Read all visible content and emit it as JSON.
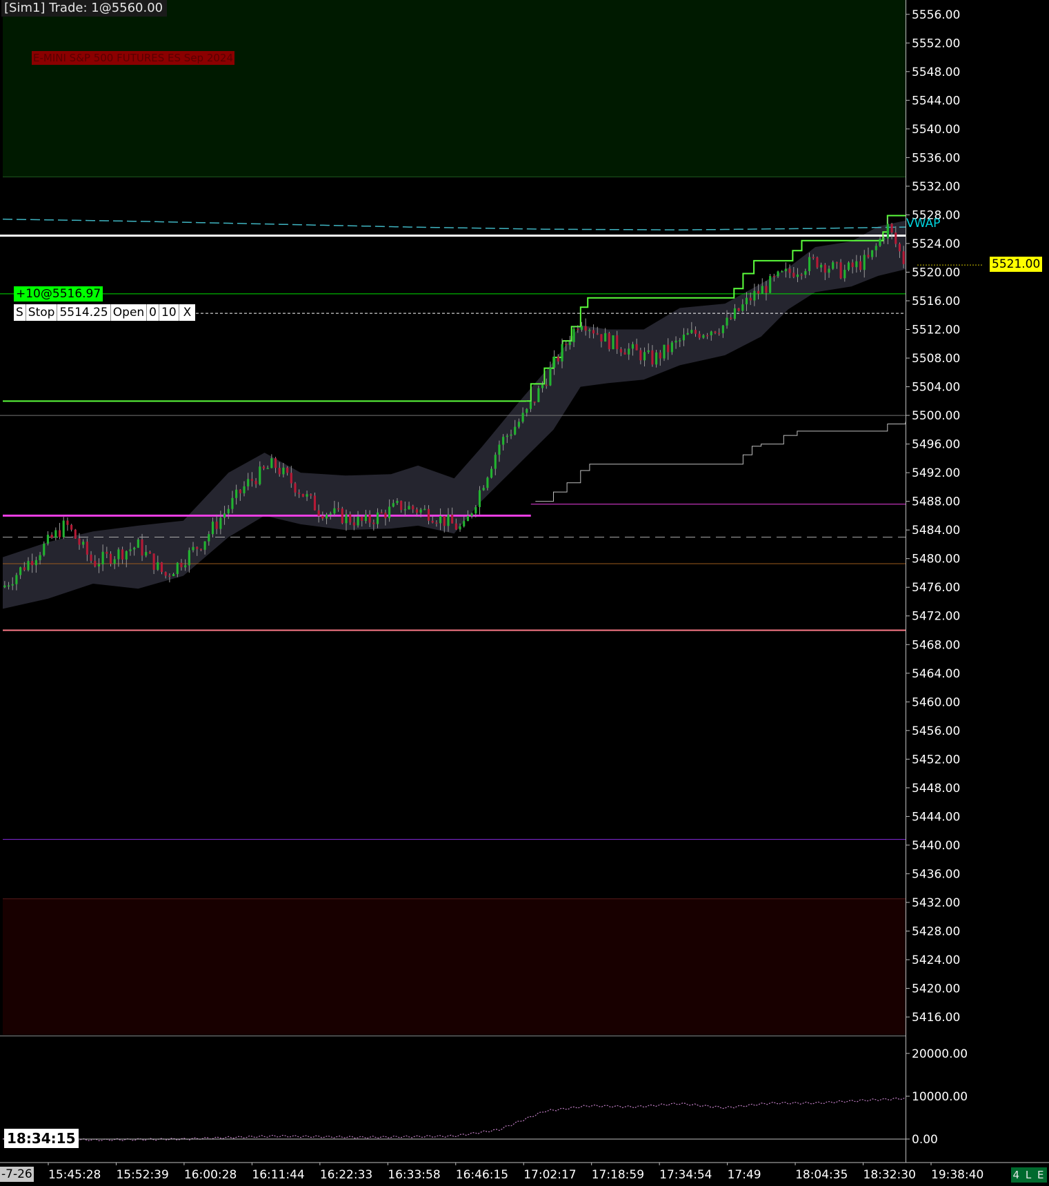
{
  "overlays": {
    "sim_trade": "[Sim1]  Trade: 1@5560.00",
    "instrument": "E-MINI S&P 500 FUTURES ES Sep 2024",
    "position": "+10@5516.97",
    "order": {
      "side": "S",
      "type": "Stop",
      "price": "5514.25",
      "state": "Open",
      "filled": "0",
      "qty": "10",
      "cancel": "X"
    },
    "last_price": "5521.00",
    "vwap_label": "VWAP",
    "clock": "18:34:15",
    "corner_date": "-7-26",
    "mode_badge": "4 L E"
  },
  "colors": {
    "background": "#000000",
    "up_candle": "#22b430",
    "down_candle": "#b51a36",
    "band_fill": "#25252f",
    "green_zone": "#001a00",
    "red_zone": "#180000",
    "stair_line": "#5cff3c",
    "vwap_line": "#3fb5c2",
    "white_level": "#ffffff",
    "green_level": "#00e000",
    "magenta_level": "#ee3fe6",
    "purple_level": "#8a2be2",
    "pink_level": "#ff7b8a",
    "orange_level": "#9c5a1c",
    "axis_text": "#ffffff",
    "last_price_bg": "#ffff00"
  },
  "chart_data": [
    {
      "type": "candlestick",
      "title": "",
      "y_axis": {
        "ticks": [
          "5556.00",
          "5552.00",
          "5548.00",
          "5544.00",
          "5540.00",
          "5536.00",
          "5532.00",
          "5528.00",
          "5524.00",
          "5520.00",
          "5516.00",
          "5512.00",
          "5508.00",
          "5504.00",
          "5500.00",
          "5496.00",
          "5492.00",
          "5488.00",
          "5484.00",
          "5480.00",
          "5476.00",
          "5472.00",
          "5468.00",
          "5464.00",
          "5460.00",
          "5456.00",
          "5452.00",
          "5448.00",
          "5444.00",
          "5440.00",
          "5436.00",
          "5432.00",
          "5428.00",
          "5424.00",
          "5420.00",
          "5416.00"
        ],
        "range": [
          5413.5,
          5558
        ]
      },
      "x_axis": {
        "ticks": [
          "15:45:28",
          "15:52:39",
          "16:00:28",
          "16:11:44",
          "16:22:33",
          "16:33:58",
          "16:46:15",
          "17:02:17",
          "17:18:59",
          "17:34:54",
          "17:49",
          "18:04:35",
          "18:32:30",
          "19:38:40"
        ]
      },
      "horizontal_levels": [
        {
          "name": "trade-level",
          "price": 5525.1,
          "color": "#ffffff"
        },
        {
          "name": "position-entry",
          "price": 5516.97,
          "color": "#00e000"
        },
        {
          "name": "stop-order",
          "price": 5514.25,
          "color": "#ffffff",
          "dashed": true
        },
        {
          "name": "prior-high-green",
          "price": 5502.0,
          "color": "#5cff3c"
        },
        {
          "name": "round-5500",
          "price": 5500.0,
          "color": "#777777"
        },
        {
          "name": "magenta-left",
          "price": 5486.0,
          "color": "#ee3fe6"
        },
        {
          "name": "magenta-right",
          "price": 5487.6,
          "color": "#ee3fe6"
        },
        {
          "name": "gray-dashed",
          "price": 5483.0,
          "color": "#aaaaaa",
          "dashed": true
        },
        {
          "name": "orange-level",
          "price": 5479.3,
          "color": "#9c5a1c"
        },
        {
          "name": "pink-level",
          "price": 5470.0,
          "color": "#ff7b8a"
        },
        {
          "name": "purple-level",
          "price": 5440.8,
          "color": "#8a2be2"
        }
      ],
      "zones": [
        {
          "name": "green-zone",
          "from": 5533.3,
          "to": 5558,
          "color": "#001a00"
        },
        {
          "name": "red-zone",
          "from": 5413.5,
          "to": 5432.5,
          "color": "#180000"
        }
      ],
      "vwap": [
        [
          0,
          5527.4
        ],
        [
          0.15,
          5527.1
        ],
        [
          0.3,
          5526.7
        ],
        [
          0.45,
          5526.3
        ],
        [
          0.6,
          5526.0
        ],
        [
          0.75,
          5525.9
        ],
        [
          0.9,
          5526.1
        ],
        [
          1.0,
          5526.3
        ]
      ],
      "stair_high": [
        [
          0.58,
          5502.0
        ],
        [
          0.585,
          5504.4
        ],
        [
          0.6,
          5506.6
        ],
        [
          0.61,
          5508.1
        ],
        [
          0.62,
          5510.4
        ],
        [
          0.63,
          5512.4
        ],
        [
          0.64,
          5515.1
        ],
        [
          0.648,
          5516.4
        ],
        [
          0.8,
          5516.4
        ],
        [
          0.81,
          5517.7
        ],
        [
          0.82,
          5519.8
        ],
        [
          0.832,
          5521.6
        ],
        [
          0.87,
          5521.6
        ],
        [
          0.875,
          5523.0
        ],
        [
          0.885,
          5524.4
        ],
        [
          0.97,
          5524.4
        ],
        [
          0.975,
          5525.6
        ],
        [
          0.98,
          5527.9
        ],
        [
          1.0,
          5527.9
        ]
      ],
      "stair_low": [
        [
          0.59,
          5488.0
        ],
        [
          0.61,
          5489.3
        ],
        [
          0.625,
          5490.6
        ],
        [
          0.64,
          5492.3
        ],
        [
          0.65,
          5493.2
        ],
        [
          0.816,
          5493.2
        ],
        [
          0.82,
          5494.5
        ],
        [
          0.83,
          5495.7
        ],
        [
          0.84,
          5496.0
        ],
        [
          0.865,
          5497.2
        ],
        [
          0.88,
          5497.8
        ],
        [
          0.97,
          5497.8
        ],
        [
          0.98,
          5498.8
        ],
        [
          1.0,
          5499.1
        ]
      ],
      "band": [
        [
          0,
          5480.2,
          5473.0
        ],
        [
          0.05,
          5482.3,
          5474.4
        ],
        [
          0.1,
          5483.8,
          5476.5
        ],
        [
          0.15,
          5484.6,
          5475.8
        ],
        [
          0.2,
          5485.3,
          5477.6
        ],
        [
          0.25,
          5492.0,
          5483.0
        ],
        [
          0.29,
          5494.8,
          5486.0
        ],
        [
          0.33,
          5492.0,
          5484.8
        ],
        [
          0.38,
          5491.6,
          5484.0
        ],
        [
          0.43,
          5491.8,
          5484.2
        ],
        [
          0.46,
          5493.0,
          5484.6
        ],
        [
          0.5,
          5491.2,
          5483.5
        ],
        [
          0.53,
          5495.5,
          5488.0
        ],
        [
          0.57,
          5501.6,
          5493.0
        ],
        [
          0.61,
          5507.5,
          5498.0
        ],
        [
          0.64,
          5512.6,
          5504.0
        ],
        [
          0.67,
          5512.0,
          5504.5
        ],
        [
          0.71,
          5512.0,
          5505.0
        ],
        [
          0.75,
          5515.0,
          5507.0
        ],
        [
          0.8,
          5515.6,
          5508.4
        ],
        [
          0.84,
          5518.4,
          5511.0
        ],
        [
          0.87,
          5520.6,
          5514.8
        ],
        [
          0.9,
          5523.5,
          5517.2
        ],
        [
          0.94,
          5524.3,
          5518.0
        ],
        [
          0.97,
          5526.4,
          5519.5
        ],
        [
          1.0,
          5527.2,
          5520.4
        ]
      ],
      "price_path": [
        [
          0,
          5476.0
        ],
        [
          0.04,
          5481.0
        ],
        [
          0.07,
          5484.8
        ],
        [
          0.1,
          5479.4
        ],
        [
          0.15,
          5481.8
        ],
        [
          0.18,
          5477.6
        ],
        [
          0.22,
          5482.2
        ],
        [
          0.27,
          5490.4
        ],
        [
          0.3,
          5493.2
        ],
        [
          0.35,
          5486.8
        ],
        [
          0.4,
          5485.0
        ],
        [
          0.44,
          5487.4
        ],
        [
          0.47,
          5486.5
        ],
        [
          0.51,
          5484.0
        ],
        [
          0.55,
          5496.0
        ],
        [
          0.58,
          5500.3
        ],
        [
          0.61,
          5507.0
        ],
        [
          0.64,
          5513.5
        ],
        [
          0.67,
          5510.4
        ],
        [
          0.72,
          5507.8
        ],
        [
          0.76,
          5511.2
        ],
        [
          0.8,
          5512.6
        ],
        [
          0.83,
          5516.6
        ],
        [
          0.86,
          5519.3
        ],
        [
          0.9,
          5521.6
        ],
        [
          0.93,
          5520.0
        ],
        [
          0.96,
          5521.8
        ],
        [
          0.98,
          5526.4
        ],
        [
          1.0,
          5521.0
        ]
      ],
      "last_price": 5521.0
    },
    {
      "type": "line",
      "title": "",
      "y_axis": {
        "ticks": [
          "20000.00",
          "10000.00",
          "0.00"
        ],
        "range": [
          -5000,
          24000
        ]
      },
      "series": [
        {
          "name": "",
          "values": [
            [
              0,
              0
            ],
            [
              0.1,
              -200
            ],
            [
              0.2,
              0
            ],
            [
              0.3,
              700
            ],
            [
              0.4,
              400
            ],
            [
              0.5,
              700
            ],
            [
              0.55,
              2200
            ],
            [
              0.6,
              6500
            ],
            [
              0.65,
              7800
            ],
            [
              0.7,
              7500
            ],
            [
              0.75,
              8300
            ],
            [
              0.8,
              7300
            ],
            [
              0.85,
              8400
            ],
            [
              0.9,
              8400
            ],
            [
              0.95,
              9000
            ],
            [
              1.0,
              9500
            ]
          ]
        }
      ]
    }
  ]
}
